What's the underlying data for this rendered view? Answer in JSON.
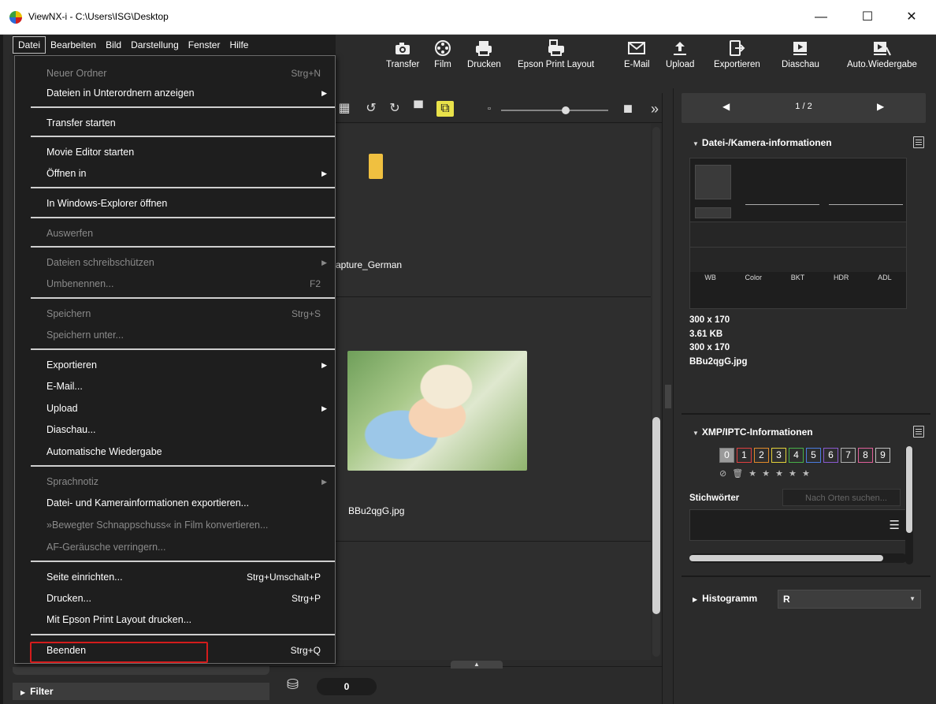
{
  "window": {
    "title": "ViewNX-i - C:\\Users\\ISG\\Desktop",
    "minimize": "—",
    "maximize": "☐",
    "close": "✕"
  },
  "menubar": {
    "items": [
      "Datei",
      "Bearbeiten",
      "Bild",
      "Darstellung",
      "Fenster",
      "Hilfe"
    ]
  },
  "toolbar": {
    "buttons": [
      "Transfer",
      "Film",
      "Drucken",
      "Epson Print Layout",
      "E-Mail",
      "Upload",
      "Exportieren",
      "Diaschau",
      "Auto.Wiedergabe"
    ]
  },
  "browser": {
    "folder_label": "apture_German",
    "file_label": "BBu2qgG.jpg",
    "counter": "0"
  },
  "left_panel": {
    "filter_label": "Filter"
  },
  "right_panel": {
    "page": "1 / 2",
    "cam_section": "Datei-/Kamera-informationen",
    "cam_tags": [
      "WB",
      "Color",
      "BKT",
      "HDR",
      "ADL"
    ],
    "file_info": [
      "300 x 170",
      "3.61 KB",
      "300 x 170",
      "BBu2qgG.jpg"
    ],
    "xmp_section": "XMP/IPTC-Informationen",
    "labels": [
      "0",
      "1",
      "2",
      "3",
      "4",
      "5",
      "6",
      "7",
      "8",
      "9"
    ],
    "label_colors": [
      "#9a9a9a",
      "#e04040",
      "#e08a2a",
      "#e2d13a",
      "#48b048",
      "#4a7ce0",
      "#8a5ad0",
      "#b0b0b0",
      "#e0609a",
      "#c0c0c0"
    ],
    "stars": "⊘ 🗑 ★ ★ ★ ★ ★",
    "keywords_label": "Stichwörter",
    "keywords_placeholder": "Nach Orten suchen...",
    "histogram_label": "Histogramm",
    "histogram_channel": "R"
  },
  "file_menu": {
    "items": [
      {
        "label": "Neuer Ordner",
        "shortcut": "Strg+N",
        "disabled": true
      },
      {
        "label": "Dateien in Unterordnern anzeigen",
        "submenu": true
      },
      {
        "label": "Transfer starten"
      },
      {
        "label": "Movie Editor starten"
      },
      {
        "label": "Öffnen in",
        "submenu": true
      },
      {
        "label": "In Windows-Explorer öffnen"
      },
      {
        "label": "Auswerfen",
        "disabled": true
      },
      {
        "label": "Dateien schreibschützen",
        "submenu": true,
        "disabled": true
      },
      {
        "label": "Umbenennen...",
        "shortcut": "F2",
        "disabled": true
      },
      {
        "label": "Speichern",
        "shortcut": "Strg+S",
        "disabled": true
      },
      {
        "label": "Speichern unter...",
        "disabled": true
      },
      {
        "label": "Exportieren",
        "submenu": true
      },
      {
        "label": "E-Mail..."
      },
      {
        "label": "Upload",
        "submenu": true
      },
      {
        "label": "Diaschau..."
      },
      {
        "label": "Automatische Wiedergabe"
      },
      {
        "label": "Sprachnotiz",
        "submenu": true,
        "disabled": true
      },
      {
        "label": "Datei- und Kamerainformationen exportieren..."
      },
      {
        "label": "»Bewegter Schnappschuss« in Film konvertieren...",
        "disabled": true
      },
      {
        "label": "AF-Geräusche verringern...",
        "disabled": true
      },
      {
        "label": "Seite einrichten...",
        "shortcut": "Strg+Umschalt+P"
      },
      {
        "label": "Drucken...",
        "shortcut": "Strg+P"
      },
      {
        "label": "Mit Epson Print Layout drucken..."
      },
      {
        "label": "Beenden",
        "shortcut": "Strg+Q"
      }
    ]
  }
}
